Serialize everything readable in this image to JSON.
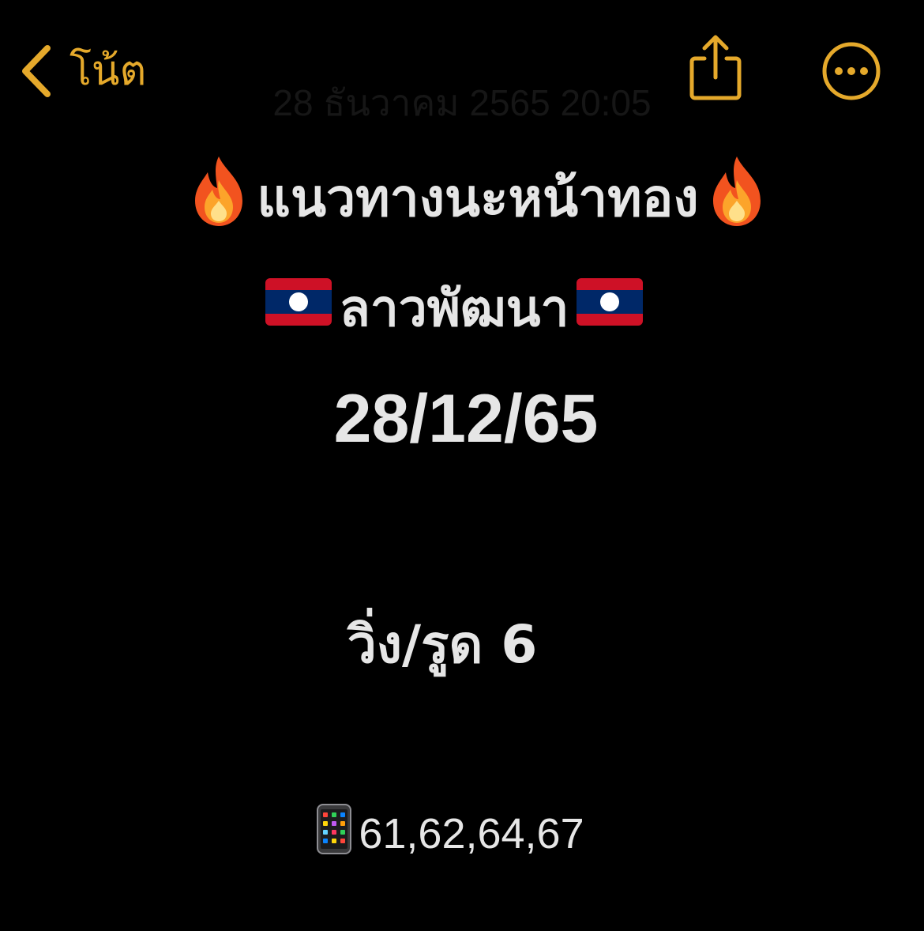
{
  "nav": {
    "back_label": "โน้ต",
    "accent_color": "#e5a92b"
  },
  "note": {
    "timestamp": "28 ธันวาคม 2565 20:05",
    "title": "แนวทางนะหน้าทอง",
    "subtitle": "ลาวพัฒนา",
    "date": "28/12/65",
    "run": "วิ่ง/รูด 6",
    "numbers": "61,62,64,67"
  },
  "icons": {
    "back": "chevron-left-icon",
    "share": "share-icon",
    "more": "more-icon",
    "title_decoration": "fire-icon",
    "subtitle_decoration": "laos-flag-icon",
    "numbers_decoration": "mobile-phone-icon"
  },
  "colors": {
    "background": "#000000",
    "text": "#e6e6e6",
    "timestamp": "#161616",
    "flag_red": "#ce1126",
    "flag_blue": "#002868"
  }
}
